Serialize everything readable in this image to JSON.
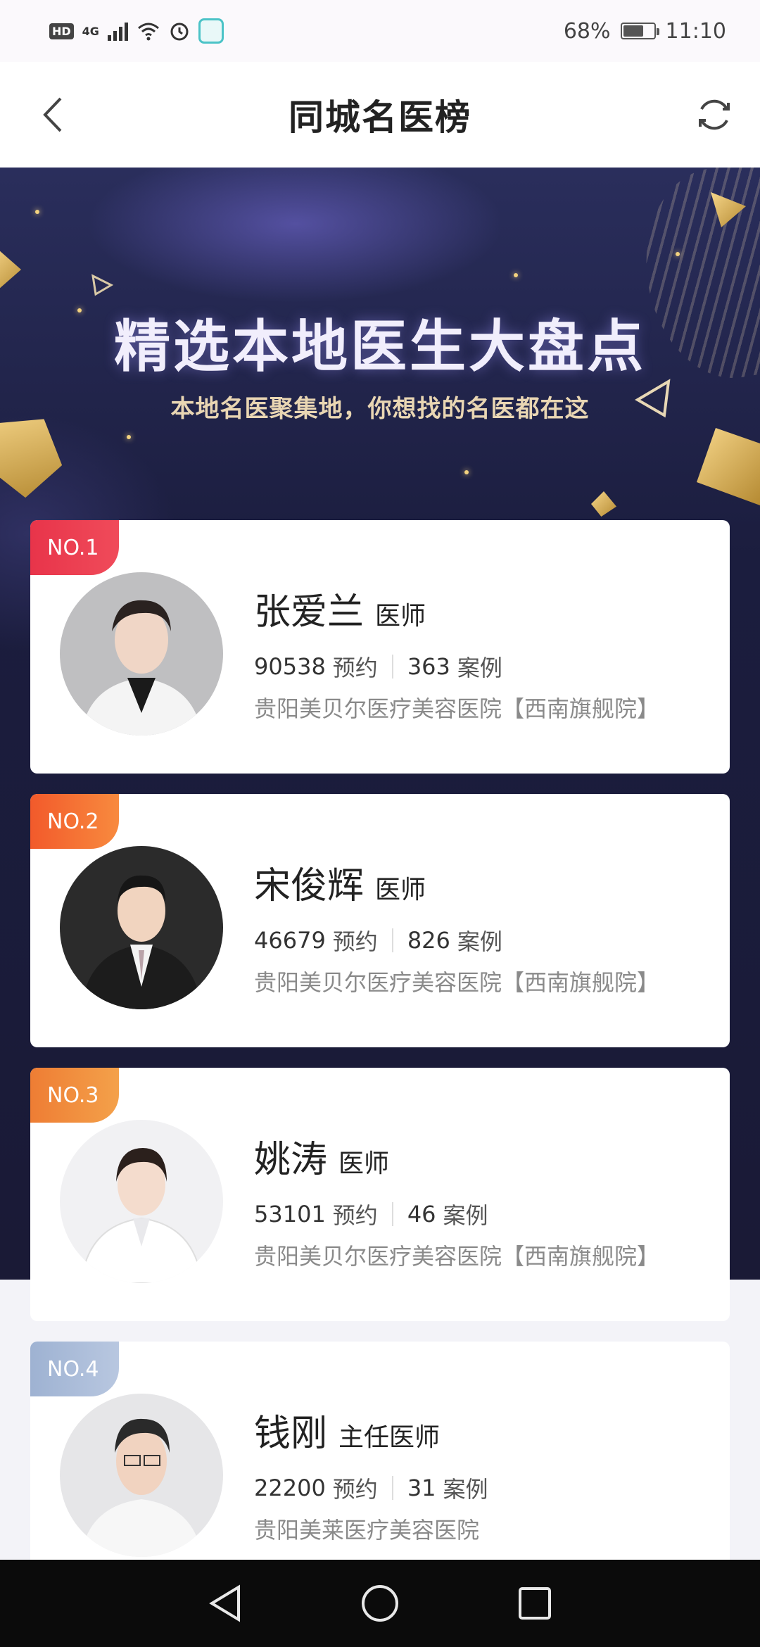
{
  "status_bar": {
    "left_badge": "HD",
    "network": "4G",
    "battery_percent": "68%",
    "battery_level": 0.68,
    "time": "11:10"
  },
  "header": {
    "title": "同城名医榜"
  },
  "banner": {
    "title": "精选本地医生大盘点",
    "subtitle": "本地名医聚集地，你想找的名医都在这"
  },
  "doctors": [
    {
      "rank": "NO.1",
      "name": "张爱兰",
      "title": "医师",
      "appointments": "90538",
      "appointments_label": "预约",
      "cases": "363",
      "cases_label": "案例",
      "hospital": "贵阳美贝尔医疗美容医院【西南旗舰院】"
    },
    {
      "rank": "NO.2",
      "name": "宋俊辉",
      "title": "医师",
      "appointments": "46679",
      "appointments_label": "预约",
      "cases": "826",
      "cases_label": "案例",
      "hospital": "贵阳美贝尔医疗美容医院【西南旗舰院】"
    },
    {
      "rank": "NO.3",
      "name": "姚涛",
      "title": "医师",
      "appointments": "53101",
      "appointments_label": "预约",
      "cases": "46",
      "cases_label": "案例",
      "hospital": "贵阳美贝尔医疗美容医院【西南旗舰院】"
    },
    {
      "rank": "NO.4",
      "name": "钱刚",
      "title": "主任医师",
      "appointments": "22200",
      "appointments_label": "预约",
      "cases": "31",
      "cases_label": "案例",
      "hospital": "贵阳美莱医疗美容医院"
    }
  ],
  "icons": {
    "back": "back-arrow-icon",
    "refresh": "refresh-icon",
    "nav_back": "triangle-back-icon",
    "nav_home": "circle-home-icon",
    "nav_recents": "square-recents-icon"
  }
}
